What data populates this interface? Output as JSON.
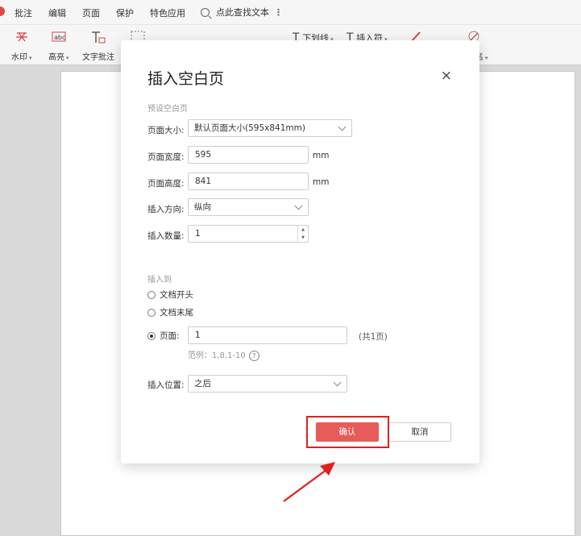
{
  "menu": {
    "items": [
      "批注",
      "编辑",
      "页面",
      "保护",
      "特色应用"
    ],
    "search_label": "点此查找文本",
    "more": "⋮"
  },
  "toolbar": {
    "watermark_label": "水印",
    "highlight_label": "高亮",
    "text_annotation_label": "文字批注",
    "underline_label": "下划线",
    "insert_symbol_label": "插入符",
    "signature_fragment": "名"
  },
  "dialog": {
    "title": "插入空白页",
    "close": "×",
    "preset_section": "预设空白页",
    "page_size_label": "页面大小:",
    "page_size_value": "默认页面大小(595x841mm)",
    "width_label": "页面宽度:",
    "width_value": "595",
    "height_label": "页面高度:",
    "height_value": "841",
    "unit": "mm",
    "orientation_label": "插入方向:",
    "orientation_value": "纵向",
    "count_label": "插入数量:",
    "count_value": "1",
    "insert_to_section": "插入到",
    "option_start": "文档开头",
    "option_end": "文档末尾",
    "option_page": "页面:",
    "page_value": "1",
    "page_total": "(共1页)",
    "example": "范例：1,8,1-10",
    "position_label": "插入位置:",
    "position_value": "之后",
    "ok_label": "确认",
    "cancel_label": "取消"
  },
  "colors": {
    "accent": "#e85b5b",
    "highlight_border": "#e02020",
    "arrow": "#e02020"
  }
}
